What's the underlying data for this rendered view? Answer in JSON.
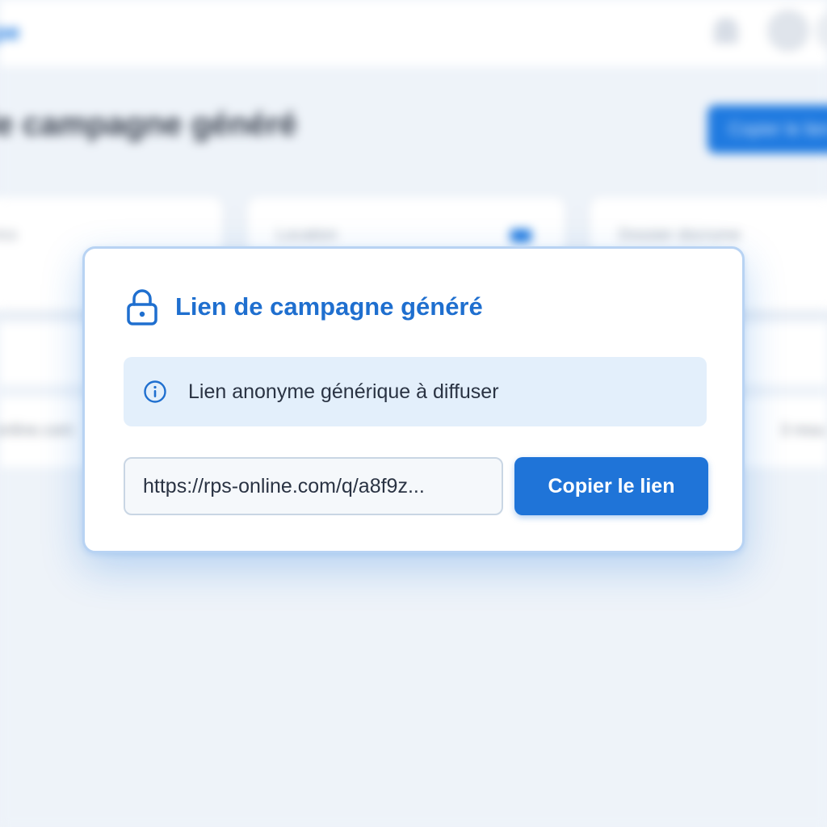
{
  "background": {
    "logo_text": "pe",
    "page_title": "de campagne généré",
    "copy_button_label": "Copier le lien",
    "cards": [
      {
        "label": "rics"
      },
      {
        "label": "Location"
      },
      {
        "label": "Dossier docrume"
      }
    ],
    "row_left_text": "online.com",
    "row_right_text": "3 mou"
  },
  "modal": {
    "title": "Lien de campagne généré",
    "title_icon": "lock-icon",
    "info": {
      "icon": "info-icon",
      "text": "Lien anonyme générique à diffuser"
    },
    "link_field": {
      "value": "https://rps-online.com/q/a8f9z..."
    },
    "copy_button_label": "Copier le lien"
  },
  "colors": {
    "accent": "#1f74d8",
    "title": "#1f6fcf",
    "info_background": "#e3effb",
    "page_background": "#eef3f9"
  }
}
